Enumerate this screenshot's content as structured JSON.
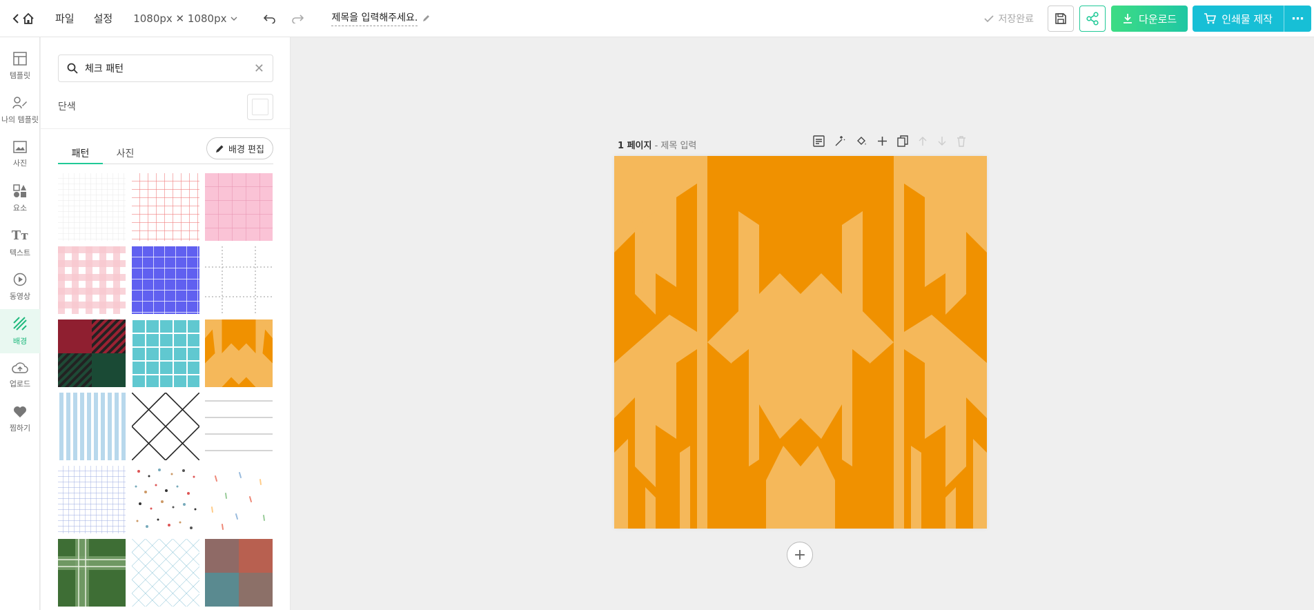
{
  "topbar": {
    "menu": [
      "파일",
      "설정"
    ],
    "canvas_size": "1080px ✕ 1080px",
    "doc_title": "제목을 입력해주세요.",
    "save_status": "저장완료",
    "download_label": "다운로드",
    "print_label": "인쇄물 제작"
  },
  "rail": {
    "items": [
      {
        "label": "템플릿",
        "icon": "layout-icon"
      },
      {
        "label": "나의 템플릿",
        "icon": "my-template-icon"
      },
      {
        "label": "사진",
        "icon": "photo-icon"
      },
      {
        "label": "요소",
        "icon": "elements-icon"
      },
      {
        "label": "텍스트",
        "icon": "text-icon"
      },
      {
        "label": "동영상",
        "icon": "video-icon"
      },
      {
        "label": "배경",
        "icon": "background-icon"
      },
      {
        "label": "업로드",
        "icon": "upload-icon"
      },
      {
        "label": "찜하기",
        "icon": "heart-icon"
      }
    ],
    "active": "배경"
  },
  "panel": {
    "search_value": "체크 패턴",
    "solid_label": "단색",
    "tabs": [
      "패턴",
      "사진"
    ],
    "active_tab": "패턴",
    "edit_bg_label": "배경 편집",
    "patterns": [
      "fine-white-grid",
      "red-line-grid",
      "pink-grid",
      "pink-gingham",
      "blue-grid",
      "dotted-grid",
      "red-green-plaid",
      "teal-tiles",
      "orange-chevron",
      "blue-stripes",
      "black-diamond-lattice",
      "gray-horizontal-lines",
      "blue-fine-grid",
      "terrazzo",
      "confetti",
      "green-tartan",
      "blue-diamond-lattice",
      "red-teal-plaid"
    ]
  },
  "canvas": {
    "page_label": "1 페이지",
    "page_title_placeholder": "- 제목 입력",
    "colors": {
      "light": "#f5b85a",
      "dark": "#f09100"
    }
  },
  "colors": {
    "accent": "#20c997",
    "print": "#17bfd6"
  }
}
